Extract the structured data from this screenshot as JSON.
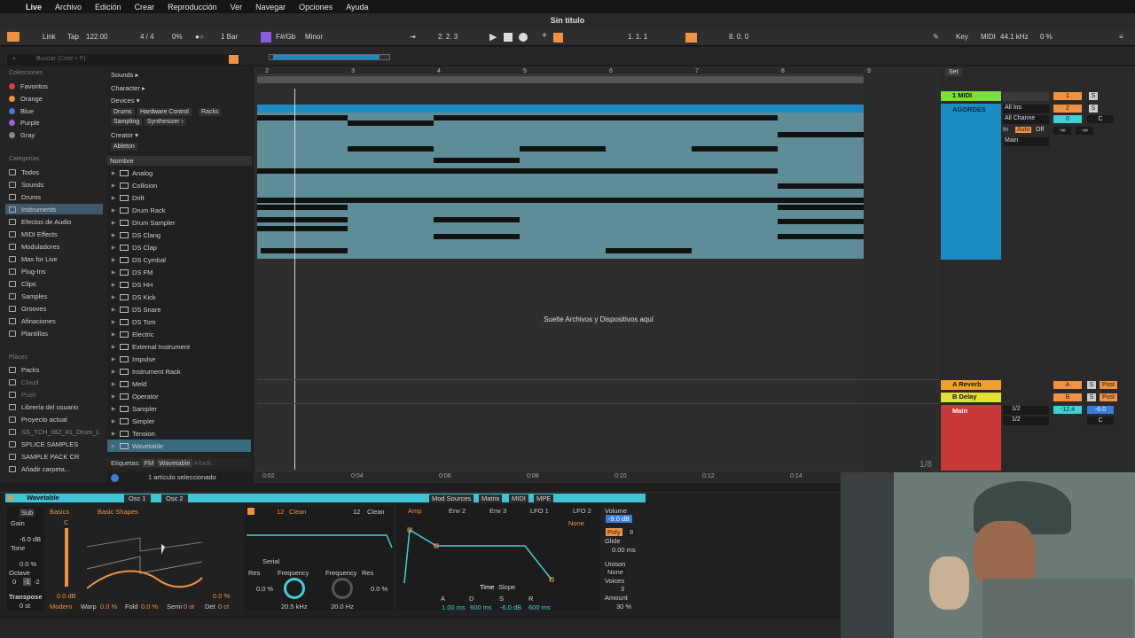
{
  "menubar": {
    "app": "Live",
    "items": [
      "Archivo",
      "Edición",
      "Crear",
      "Reproducción",
      "Ver",
      "Navegar",
      "Opciones",
      "Ayuda"
    ]
  },
  "title": "Sin título",
  "transport": {
    "link": "Link",
    "tap": "Tap",
    "tempo": "122.00",
    "signature": "4 / 4",
    "cpu": "0%",
    "quant": "1 Bar",
    "key": "F#/Gb",
    "scale": "Minor",
    "position": "2.   2.   3",
    "loop_start": "1.   1.   1",
    "loop_len": "8.   0.   0",
    "key_label": "Key",
    "midi_label": "MIDI",
    "sample_rate": "44.1 kHz",
    "load": "0 %"
  },
  "search": {
    "placeholder": "Buscar (Cmd + F)"
  },
  "sidebar": {
    "collections_header": "Colecciones",
    "collections": [
      {
        "label": "Favoritos",
        "color": "#e03a3a"
      },
      {
        "label": "Orange",
        "color": "#f0902c"
      },
      {
        "label": "Blue",
        "color": "#3a7de0"
      },
      {
        "label": "Purple",
        "color": "#a55ee0"
      },
      {
        "label": "Gray",
        "color": "#8a8a8a"
      }
    ],
    "categories_header": "Categorías",
    "categories": [
      "Todos",
      "Sounds",
      "Drums",
      "Instruments",
      "Efectos de Audio",
      "MIDI Effects",
      "Moduladores",
      "Max for Live",
      "Plug-Ins",
      "Clips",
      "Samples",
      "Grooves",
      "Afinaciones",
      "Plantillas"
    ],
    "places_header": "Places",
    "places": [
      "Packs",
      "Cloud",
      "Push",
      "Librería del usuario",
      "Proyecto actual",
      "SS_TCH_IBZ_#1_Drum_L",
      "SPLICE SAMPLES",
      "SAMPLE PACK CR",
      "Añadir carpeta..."
    ]
  },
  "filters": {
    "sounds": "Sounds ▸",
    "character": "Character ▸",
    "devices": "Devices ▾",
    "device_tags": [
      "Drums",
      "Hardware Control",
      "Racks",
      "Sampling",
      "Synthesizer ›"
    ],
    "creator": "Creator ▾",
    "creator_tags": [
      "Ableton"
    ]
  },
  "filelist": {
    "header": "Nombre",
    "items": [
      "Analog",
      "Collision",
      "Drift",
      "Drum Rack",
      "Drum Sampler",
      "DS Clang",
      "DS Clap",
      "DS Cymbal",
      "DS FM",
      "DS HH",
      "DS Kick",
      "DS Snare",
      "DS Tom",
      "Electric",
      "External Instrument",
      "Impulse",
      "Instrument Rack",
      "Meld",
      "Operator",
      "Sampler",
      "Simpler",
      "Tension",
      "Wavetable"
    ]
  },
  "tags": {
    "label": "Etiquetas:",
    "values": [
      "FM",
      "Wavetable",
      "Añadi..."
    ]
  },
  "status": "1 artículo seleccionado",
  "ruler": [
    "2",
    "3",
    "4",
    "5",
    "6",
    "7",
    "8",
    "9"
  ],
  "timeruler": [
    "0:02",
    "0:04",
    "0:06",
    "0:08",
    "0:10",
    "0:12",
    "0:14"
  ],
  "drop_text": "Suelte Archivos y Dispositivos aquí",
  "zoom": "1/8",
  "mixer": {
    "set": "Set",
    "track1": "1 MIDI",
    "track2": "AGORDES",
    "input": "All Ins",
    "channel": "All Channe",
    "monitor": [
      "In",
      "Auto",
      "Off"
    ],
    "out": "Main",
    "num1": "1",
    "num2": "2",
    "vol0": "0",
    "c": "C",
    "inf": "-∞",
    "returnA": "A Reverb",
    "returnB": "B Delay",
    "main": "Main",
    "half": "1/2",
    "a": "A",
    "b": "B",
    "s": "S",
    "post": "Post",
    "master_vol": "-12.4",
    "master_vol2": "-6.0"
  },
  "device": {
    "name": "Wavetable",
    "osc1": "Osc 1",
    "osc2": "Osc 2",
    "sub": "Sub",
    "gain": "Gain",
    "gain_val": "-6.0 dB",
    "tone": "Tone",
    "tone_val": "0.0 %",
    "octave": "Octave",
    "oct_vals": [
      "0",
      "-1",
      "-2"
    ],
    "transpose": "Transpose",
    "transpose_val": "0 st",
    "category": "Basics",
    "wavetable": "Basic Shapes",
    "c_label": "C",
    "osc_gain": "0.0 dB",
    "pos": "0.0 %",
    "mode": "Modern",
    "warp": "Warp",
    "warp_val": "0.0 %",
    "fold": "Fold",
    "fold_val": "0.0 %",
    "semi": "Semi",
    "semi_val": "0 st",
    "det": "Det",
    "det_val": "0 ct",
    "filter1": "Clean",
    "filter2": "Clean",
    "f12": "12",
    "routing": "Serial",
    "res": "Res",
    "res_val": "0.0 %",
    "freq": "Frequency",
    "freq_val": "20.5 kHz",
    "freq2": "Frequency",
    "res2": "Res",
    "freq2_val": "20.0 Hz",
    "res2_val": "0.0 %",
    "tabs": [
      "Mod Sources",
      "Matrix",
      "MIDI",
      "MPE"
    ],
    "env_tabs": [
      "Amp",
      "Env 2",
      "Env 3",
      "LFO 1",
      "LFO 2"
    ],
    "none": "None",
    "time": "Time",
    "slope": "Slope",
    "adsr_labels": [
      "A",
      "D",
      "S",
      "R"
    ],
    "adsr_vals": [
      "1.00 ms",
      "600 ms",
      "-6.0 dB",
      "600 ms"
    ],
    "volume": "Volume",
    "volume_val": "-9.0 dB",
    "poly": "Poly",
    "poly_val": "8",
    "glide": "Glide",
    "glide_val": "0.00 ms",
    "unison": "Unison",
    "unison_val": "None",
    "voices": "Voices",
    "voices_val": "3",
    "amount": "Amount",
    "amount_val": "30 %"
  },
  "colors": {
    "accent": "#f09340",
    "midi": "#7ddc3e",
    "clip": "#1c8dc4",
    "returnA": "#f0a030",
    "returnB": "#e4e034",
    "master": "#c83838"
  }
}
